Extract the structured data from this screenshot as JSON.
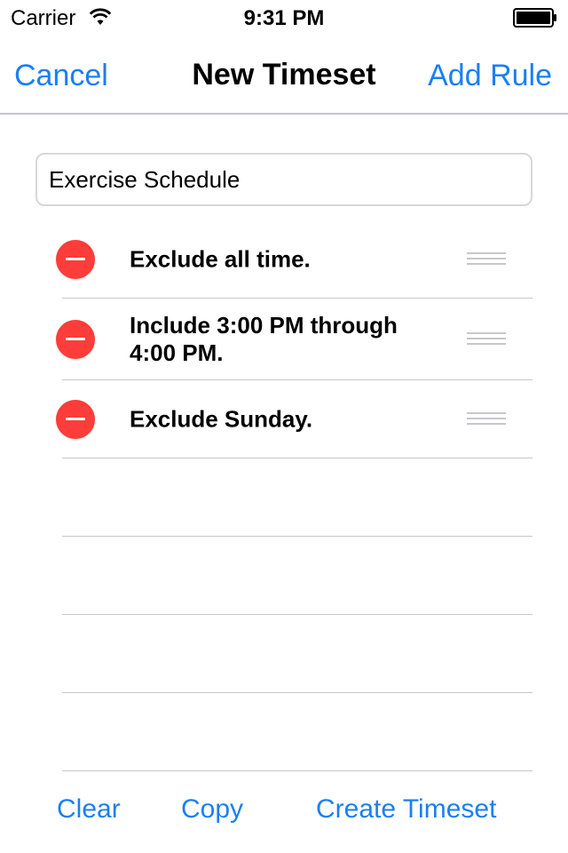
{
  "status_bar": {
    "carrier": "Carrier",
    "time": "9:31 PM",
    "icons": [
      "wifi-icon",
      "battery-icon"
    ]
  },
  "nav": {
    "cancel_label": "Cancel",
    "title": "New Timeset",
    "add_rule_label": "Add Rule"
  },
  "name_field": {
    "value": "Exercise Schedule"
  },
  "rules": [
    {
      "text": "Exclude all time."
    },
    {
      "text": "Include 3:00 PM through 4:00 PM."
    },
    {
      "text": "Exclude Sunday."
    }
  ],
  "toolbar": {
    "clear_label": "Clear",
    "copy_label": "Copy",
    "create_label": "Create Timeset"
  },
  "colors": {
    "accent": "#1a7ff5",
    "delete": "#fc3d39",
    "separator": "#c8c7cc"
  }
}
